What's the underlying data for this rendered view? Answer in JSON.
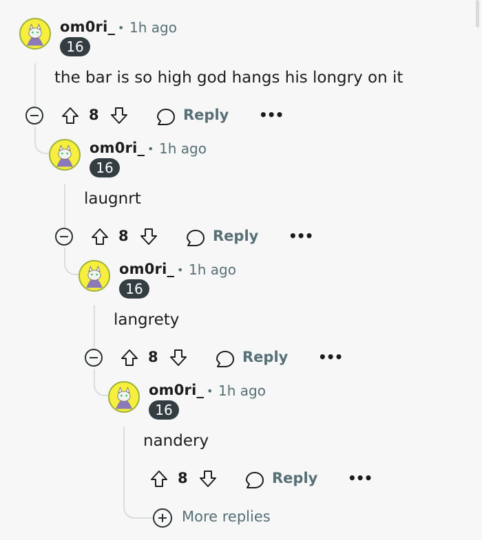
{
  "comments": [
    {
      "username": "om0ri_",
      "separator": "•",
      "time": "1h ago",
      "badge": "16",
      "text": "the bar is so high god hangs his longry on it",
      "score": "8",
      "reply_label": "Reply",
      "more_label": "•••"
    },
    {
      "username": "om0ri_",
      "separator": "•",
      "time": "1h ago",
      "badge": "16",
      "text": "laugnrt",
      "score": "8",
      "reply_label": "Reply",
      "more_label": "•••"
    },
    {
      "username": "om0ri_",
      "separator": "•",
      "time": "1h ago",
      "badge": "16",
      "text": "langrety",
      "score": "8",
      "reply_label": "Reply",
      "more_label": "•••"
    },
    {
      "username": "om0ri_",
      "separator": "•",
      "time": "1h ago",
      "badge": "16",
      "text": "nandery",
      "score": "8",
      "reply_label": "Reply",
      "more_label": "•••"
    }
  ],
  "more_replies_label": "More replies",
  "colors": {
    "background": "#f6f7f6",
    "badge": "#333d42",
    "meta_text": "#576f76",
    "thread_line": "#dadddf"
  },
  "icons": {
    "avatar": "cat-avatar-icon",
    "collapse": "collapse-minus-icon",
    "upvote": "upvote-arrow-icon",
    "downvote": "downvote-arrow-icon",
    "reply": "speech-bubble-icon",
    "more": "ellipsis-icon",
    "expand": "plus-circle-icon"
  }
}
